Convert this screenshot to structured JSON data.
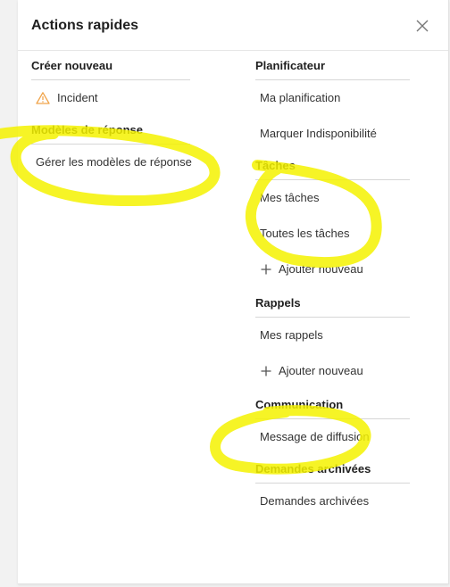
{
  "panel": {
    "title": "Actions rapides",
    "close_icon": "close-icon"
  },
  "left": {
    "create": {
      "header": "Créer nouveau",
      "items": [
        {
          "label": "Incident",
          "icon": "warning-icon",
          "icon_color": "#f0a44a"
        }
      ]
    },
    "templates": {
      "header": "Modèles de réponse",
      "items": [
        {
          "label": "Gérer les modèles de réponse"
        }
      ]
    }
  },
  "right": {
    "planner": {
      "header": "Planificateur",
      "items": [
        {
          "label": "Ma planification"
        },
        {
          "label": "Marquer Indisponibilité"
        }
      ]
    },
    "tasks": {
      "header": "Tâches",
      "items": [
        {
          "label": "Mes tâches"
        },
        {
          "label": "Toutes les tâches"
        }
      ],
      "add_label": "Ajouter nouveau"
    },
    "reminders": {
      "header": "Rappels",
      "items": [
        {
          "label": "Mes rappels"
        }
      ],
      "add_label": "Ajouter nouveau"
    },
    "communication": {
      "header": "Communication",
      "items": [
        {
          "label": "Message de diffusion"
        }
      ]
    },
    "archived": {
      "header": "Demandes archivées",
      "items": [
        {
          "label": "Demandes archivées"
        }
      ]
    }
  },
  "annotation_color": "#f5f200"
}
